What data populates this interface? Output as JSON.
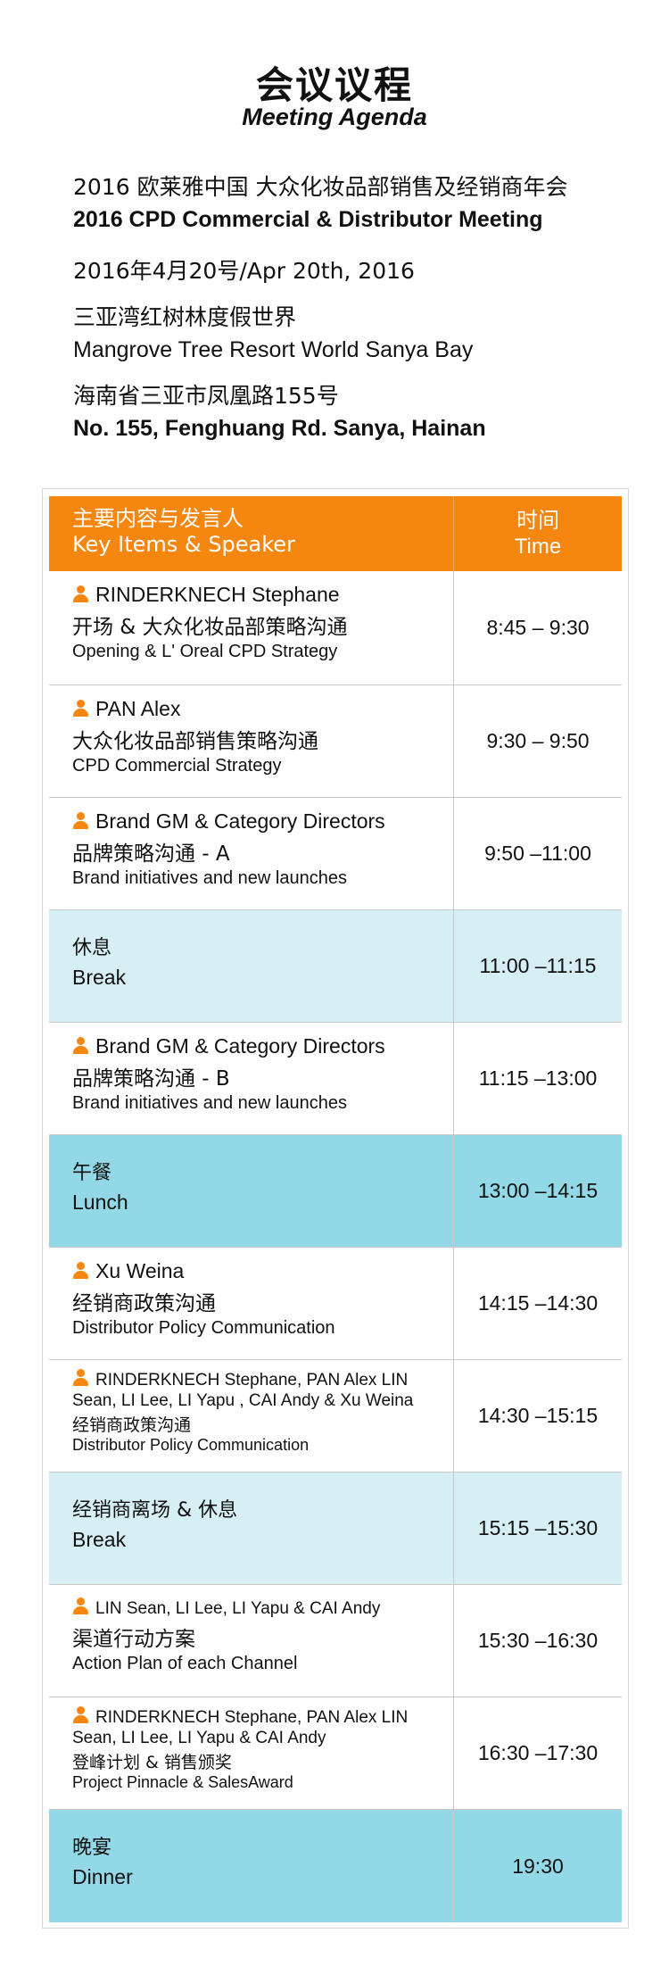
{
  "header": {
    "title_cn": "会议议程",
    "title_en": "Meeting Agenda"
  },
  "info": {
    "event_cn": "2016 欧莱雅中国 大众化妆品部销售及经销商年会",
    "event_en": "2016 CPD Commercial & Distributor Meeting",
    "date": "2016年4月20号/Apr 20th, 2016",
    "venue_cn": "三亚湾红树林度假世界",
    "venue_en": "Mangrove Tree Resort World Sanya Bay",
    "address_cn": "海南省三亚市凤凰路155号",
    "address_en": "No. 155, Fenghuang Rd. Sanya, Hainan"
  },
  "table_header": {
    "col1_cn": "主要内容与发言人",
    "col1_en": "Key Items & Speaker",
    "col2_cn": "时间",
    "col2_en": "Time"
  },
  "rows": [
    {
      "speaker": "RINDERKNECH Stephane",
      "topic_cn": "开场 & 大众化妆品部策略沟通",
      "topic_en": "Opening & L' Oreal CPD Strategy",
      "time": "8:45 – 9:30"
    },
    {
      "speaker": "PAN Alex",
      "topic_cn": "大众化妆品部销售策略沟通",
      "topic_en": "CPD Commercial Strategy",
      "time": "9:30 – 9:50"
    },
    {
      "speaker": "Brand GM & Category Directors",
      "topic_cn": "品牌策略沟通 - A",
      "topic_en": "Brand initiatives and new launches",
      "time": "9:50 –11:00"
    },
    {
      "title_cn": "休息",
      "title_en": "Break",
      "time": "11:00 –11:15"
    },
    {
      "speaker": "Brand GM & Category Directors",
      "topic_cn": "品牌策略沟通 - B",
      "topic_en": "Brand initiatives and new launches",
      "time": "11:15 –13:00"
    },
    {
      "title_cn": "午餐",
      "title_en": "Lunch",
      "time": "13:00 –14:15"
    },
    {
      "speaker": "Xu Weina",
      "topic_cn": "经销商政策沟通",
      "topic_en": "Distributor Policy Communication",
      "time": "14:15 –14:30"
    },
    {
      "speaker": "RINDERKNECH Stephane, PAN Alex LIN Sean, LI Lee, LI Yapu , CAI Andy & Xu Weina",
      "topic_cn": "经销商政策沟通",
      "topic_en": "Distributor Policy Communication",
      "time": "14:30 –15:15"
    },
    {
      "title_cn": "经销商离场 & 休息",
      "title_en": "Break",
      "time": "15:15 –15:30"
    },
    {
      "speaker": "LIN Sean, LI Lee, LI Yapu & CAI Andy",
      "topic_cn": "渠道行动方案",
      "topic_en": "Action Plan of each Channel",
      "time": "15:30 –16:30"
    },
    {
      "speaker": "RINDERKNECH Stephane, PAN Alex LIN Sean, LI Lee, LI Yapu & CAI Andy",
      "topic_cn": "登峰计划 & 销售颁奖",
      "topic_en": "Project Pinnacle & SalesAward",
      "time": "16:30 –17:30"
    },
    {
      "title_cn": "晚宴",
      "title_en": "Dinner",
      "time": "19:30"
    }
  ],
  "colors": {
    "accent": "#f5860f",
    "break_bg": "#d6eff4",
    "meal_bg": "#93d8e6"
  }
}
